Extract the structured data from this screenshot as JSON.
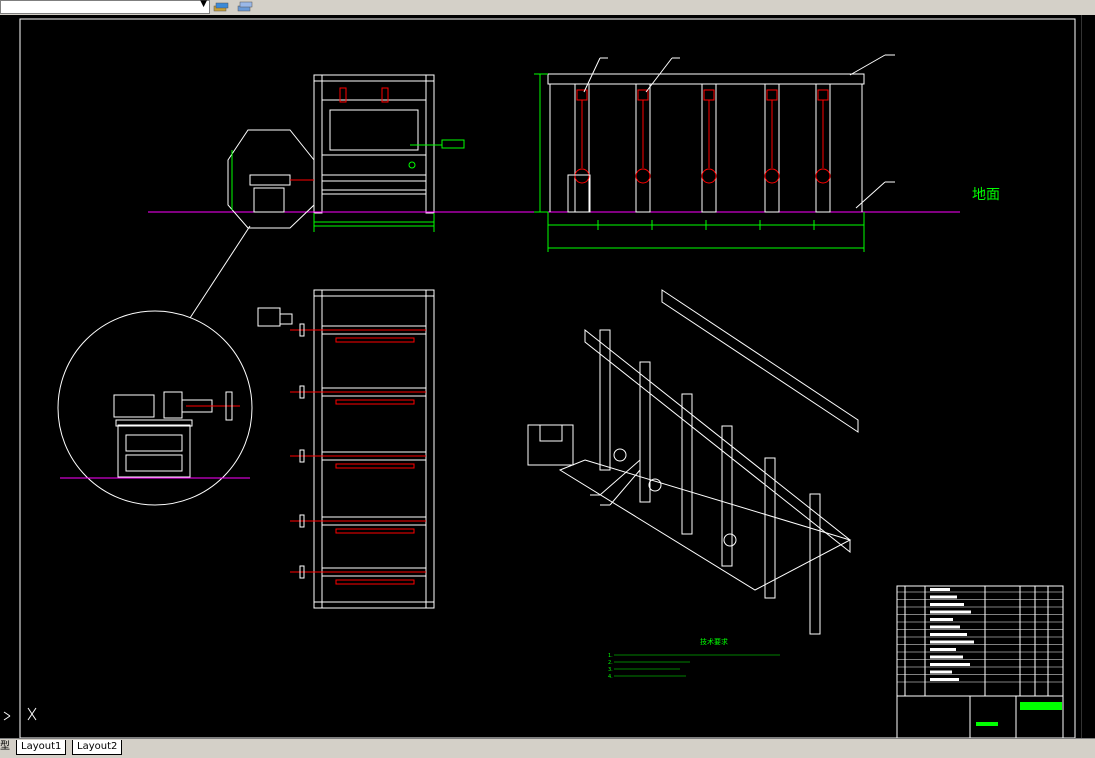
{
  "app": {
    "toolbar": {
      "layer_combo_value": "",
      "icons": [
        "layer-states-icon",
        "layer-previous-icon"
      ]
    },
    "tabs": [
      {
        "label": "Layout1"
      },
      {
        "label": "Layout2"
      }
    ],
    "model_tab_partial": "型"
  },
  "drawing": {
    "ground_label": "地面",
    "notes_title": "技术要求",
    "notes_lines": [
      "1.",
      "2.",
      "3.",
      "4."
    ],
    "colors": {
      "background": "#000000",
      "frame": "#ffffff",
      "dimension": "#00ff00",
      "ground_line": "#ff00ff",
      "centerline": "#ff0000",
      "leader": "#ffffff",
      "detail_circle": "#ffffff"
    }
  }
}
